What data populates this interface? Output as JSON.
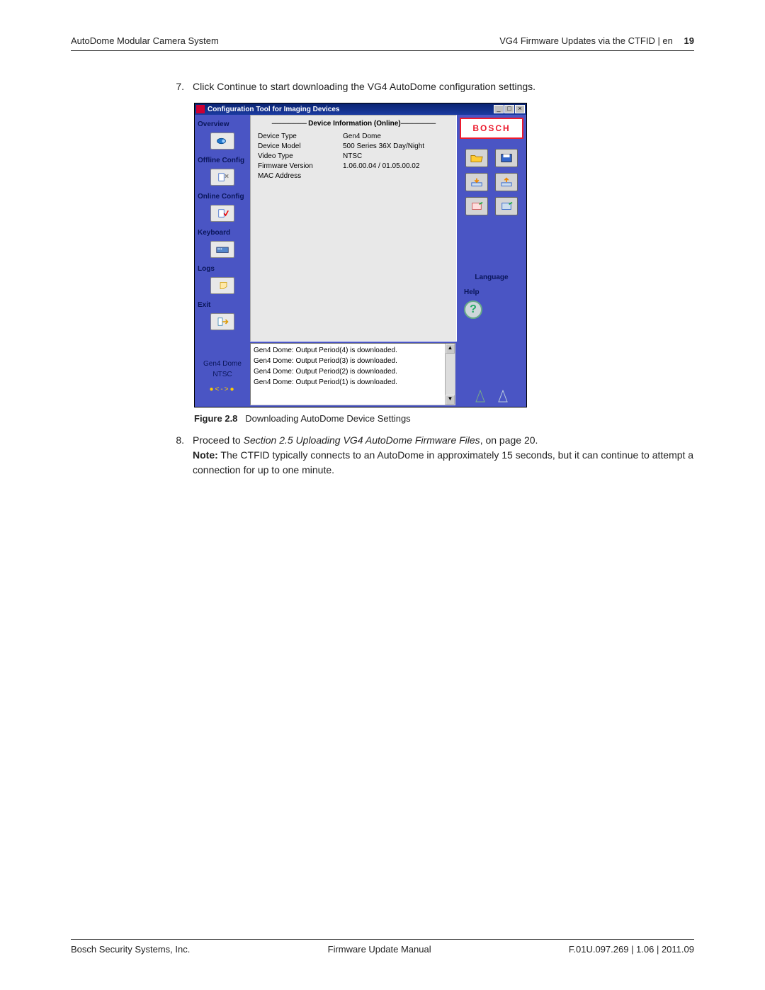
{
  "header": {
    "left": "AutoDome Modular Camera System",
    "right": "VG4 Firmware Updates via the CTFID | en",
    "page_num": "19"
  },
  "step7": {
    "num": "7.",
    "text": "Click Continue to start downloading the VG4 AutoDome configuration settings."
  },
  "app_window": {
    "title": "Configuration Tool for Imaging Devices",
    "win_buttons": {
      "min": "_",
      "max": "□",
      "close": "×"
    },
    "sidebar": [
      {
        "label": "Overview",
        "icon": "camera-icon"
      },
      {
        "label": "Offline Config",
        "icon": "doc-x-icon"
      },
      {
        "label": "Online Config",
        "icon": "doc-check-icon"
      },
      {
        "label": "Keyboard",
        "icon": "keyboard-icon"
      },
      {
        "label": "Logs",
        "icon": "note-icon"
      },
      {
        "label": "Exit",
        "icon": "exit-icon"
      }
    ],
    "device_info": {
      "heading": " Device Information (Online)",
      "rows": [
        {
          "k": "Device Type",
          "v": "Gen4 Dome"
        },
        {
          "k": "Device Model",
          "v": "500 Series 36X Day/Night"
        },
        {
          "k": "Video Type",
          "v": "NTSC"
        },
        {
          "k": "Firmware Version",
          "v": "1.06.00.04 / 01.05.00.02"
        },
        {
          "k": "MAC Address",
          "v": ""
        }
      ]
    },
    "right_icons": [
      [
        "open-icon",
        "save-icon"
      ],
      [
        "download-icon",
        "upload-icon"
      ],
      [
        "screen-out-icon",
        "screen-in-icon"
      ]
    ],
    "bosch_logo": "BOSCH",
    "lang_label": "Language",
    "help_label": "Help",
    "status_left": {
      "line1": "Gen4 Dome",
      "line2": "NTSC"
    },
    "log_lines": [
      "Gen4 Dome: Output Period(4) is downloaded.",
      "Gen4 Dome: Output Period(3) is downloaded.",
      "Gen4 Dome: Output Period(2) is downloaded.",
      "Gen4 Dome: Output Period(1) is downloaded."
    ]
  },
  "figure_caption": {
    "num": "Figure 2.8",
    "text": "Downloading AutoDome Device Settings"
  },
  "step8": {
    "num": "8.",
    "proceed_prefix": "Proceed to ",
    "section_ref": "Section 2.5 Uploading VG4 AutoDome Firmware Files",
    "proceed_suffix": ", on page 20.",
    "note_label": "Note:",
    "note_text": " The CTFID typically connects to an AutoDome in approximately 15 seconds, but it can continue to attempt a connection for up to one minute."
  },
  "footer": {
    "left": "Bosch Security Systems, Inc.",
    "center": "Firmware Update Manual",
    "right": "F.01U.097.269 | 1.06 | 2011.09"
  }
}
